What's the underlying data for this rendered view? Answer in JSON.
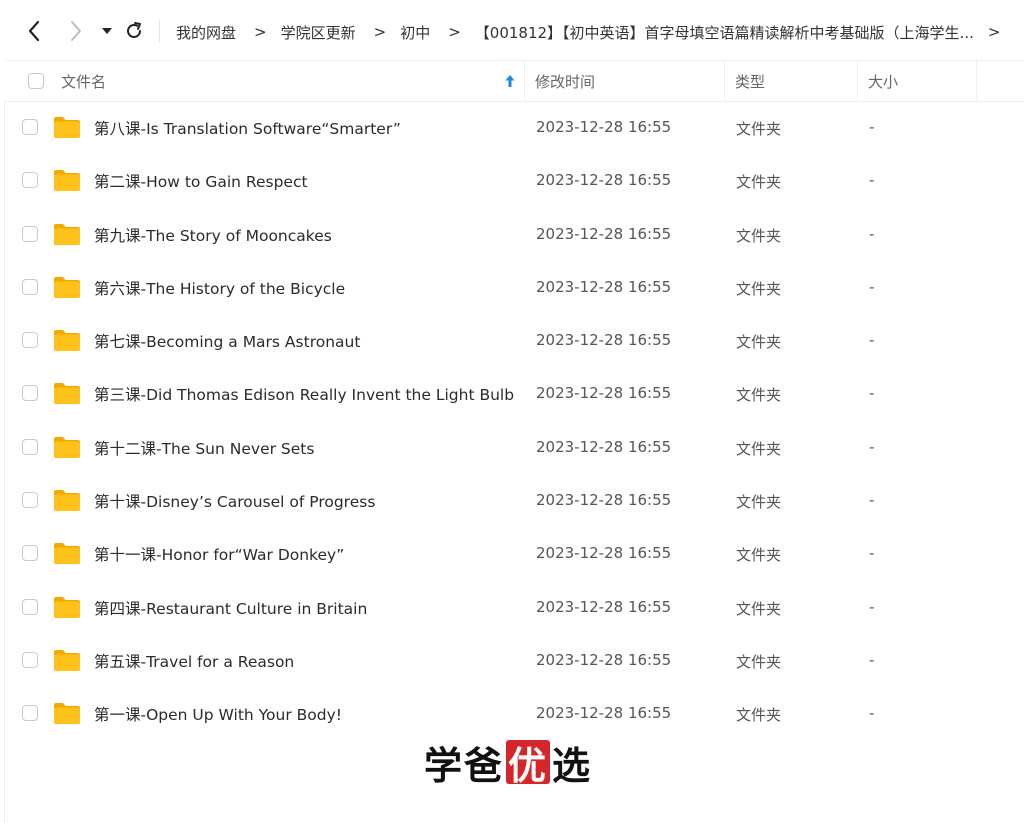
{
  "nav": {
    "back_icon": "chevron-left-icon",
    "forward_icon": "chevron-right-icon",
    "dropdown_icon": "caret-down-icon",
    "refresh_icon": "refresh-icon"
  },
  "breadcrumb": [
    "我的网盘",
    "学院区更新",
    "初中",
    "【001812】【初中英语】首字母填空语篇精读解析中考基础版（上海学生..."
  ],
  "table": {
    "columns": {
      "name": "文件名",
      "date": "修改时间",
      "type": "类型",
      "size": "大小"
    },
    "sort_icon": "sort-up-arrow-icon",
    "rows": [
      {
        "name": "第八课-Is Translation Software“Smarter”",
        "date": "2023-12-28 16:55",
        "type": "文件夹",
        "size": "-"
      },
      {
        "name": "第二课-How to Gain Respect",
        "date": "2023-12-28 16:55",
        "type": "文件夹",
        "size": "-"
      },
      {
        "name": "第九课-The Story of Mooncakes",
        "date": "2023-12-28 16:55",
        "type": "文件夹",
        "size": "-"
      },
      {
        "name": "第六课-The History of the Bicycle",
        "date": "2023-12-28 16:55",
        "type": "文件夹",
        "size": "-"
      },
      {
        "name": "第七课-Becoming a Mars Astronaut",
        "date": "2023-12-28 16:55",
        "type": "文件夹",
        "size": "-"
      },
      {
        "name": "第三课-Did Thomas Edison Really Invent the Light Bulb",
        "date": "2023-12-28 16:55",
        "type": "文件夹",
        "size": "-"
      },
      {
        "name": "第十二课-The Sun Never Sets",
        "date": "2023-12-28 16:55",
        "type": "文件夹",
        "size": "-"
      },
      {
        "name": "第十课-Disney’s Carousel of Progress",
        "date": "2023-12-28 16:55",
        "type": "文件夹",
        "size": "-"
      },
      {
        "name": "第十一课-Honor for“War Donkey”",
        "date": "2023-12-28 16:55",
        "type": "文件夹",
        "size": "-"
      },
      {
        "name": "第四课-Restaurant Culture in Britain",
        "date": "2023-12-28 16:55",
        "type": "文件夹",
        "size": "-"
      },
      {
        "name": "第五课-Travel for a Reason",
        "date": "2023-12-28 16:55",
        "type": "文件夹",
        "size": "-"
      },
      {
        "name": "第一课-Open Up With Your Body!",
        "date": "2023-12-28 16:55",
        "type": "文件夹",
        "size": "-"
      }
    ]
  },
  "watermark": {
    "part1": "学爸",
    "seal": "优",
    "part2": "选"
  },
  "colors": {
    "folder": "#FFC21A",
    "folder_tab": "#F5A800",
    "sort_arrow": "#1E88E5",
    "seal": "#D7262B"
  }
}
